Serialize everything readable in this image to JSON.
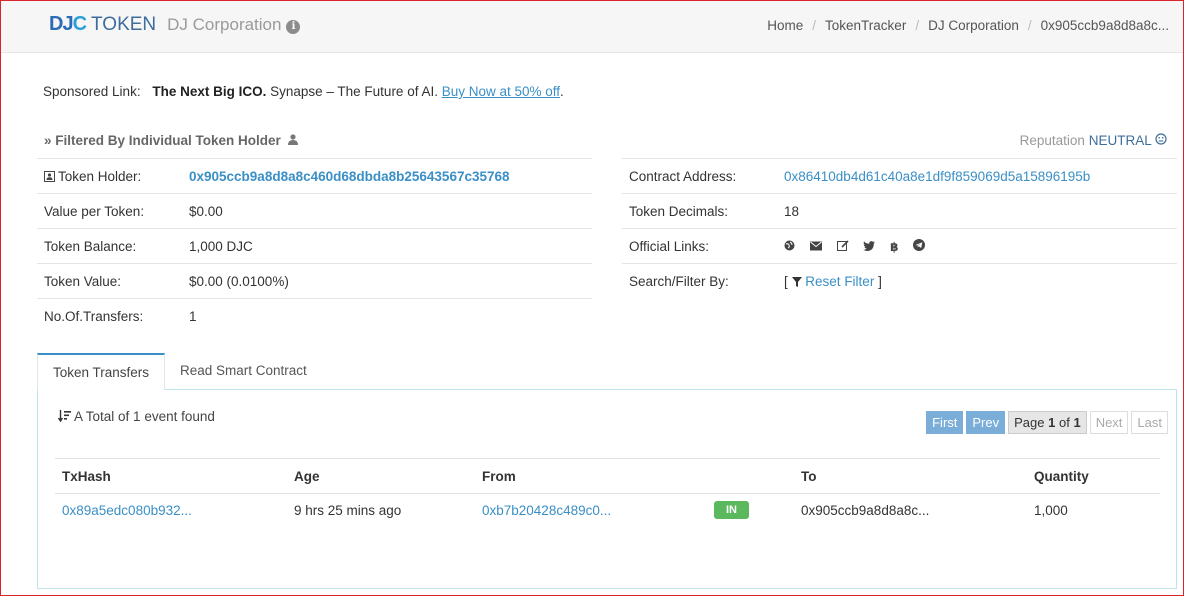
{
  "header": {
    "logo_mark_dj": "DJ",
    "logo_mark_c": "C",
    "logo_token": "TOKEN",
    "logo_name": "DJ Corporation",
    "info_glyph": "i",
    "breadcrumb": [
      "Home",
      "TokenTracker",
      "DJ Corporation",
      "0x905ccb9a8d8a8c..."
    ]
  },
  "sponsored": {
    "label": "Sponsored Link:",
    "bold": "The Next Big ICO.",
    "text": " Synapse – The Future of AI. ",
    "link": "Buy Now at 50% off",
    "tail": "."
  },
  "filter": {
    "title": "» Filtered By Individual Token Holder",
    "reputation_label": "Reputation",
    "reputation_value": "NEUTRAL"
  },
  "holder_info": {
    "token_holder_label": "Token Holder:",
    "token_holder_value": "0x905ccb9a8d8a8c460d68dbda8b25643567c35768",
    "value_per_token_label": "Value per Token:",
    "value_per_token_value": "$0.00",
    "token_balance_label": "Token Balance:",
    "token_balance_value": "1,000 DJC",
    "token_value_label": "Token Value:",
    "token_value_value": "$0.00 (0.0100%)",
    "transfers_label": "No.Of.Transfers:",
    "transfers_value": "1"
  },
  "contract_info": {
    "contract_address_label": "Contract Address:",
    "contract_address_value": "0x86410db4d61c40a8e1df9f859069d5a15896195b",
    "decimals_label": "Token Decimals:",
    "decimals_value": "18",
    "official_links_label": "Official Links:",
    "official_links_icons": [
      "globe-icon",
      "email-icon",
      "edit-icon",
      "twitter-icon",
      "bitcoin-icon",
      "telegram-icon"
    ],
    "search_filter_label": "Search/Filter By:",
    "reset_filter": "Reset Filter",
    "bracket_open": "[",
    "bracket_close": "]"
  },
  "tabs": {
    "token_transfers": "Token Transfers",
    "read_contract": "Read Smart Contract"
  },
  "transfers": {
    "total_text": "A Total of 1 event found",
    "pager": {
      "first": "First",
      "prev": "Prev",
      "page_prefix": "Page",
      "page_current": "1",
      "page_of": "of",
      "page_total": "1",
      "next": "Next",
      "last": "Last"
    },
    "columns": [
      "TxHash",
      "Age",
      "From",
      "",
      "To",
      "Quantity"
    ],
    "rows": [
      {
        "txhash": "0x89a5edc080b932...",
        "age": "9 hrs 25 mins ago",
        "from": "0xb7b20428c489c0...",
        "direction": "IN",
        "to": "0x905ccb9a8d8a8c...",
        "quantity": "1,000"
      }
    ]
  },
  "colors": {
    "accent": "#3a8fc7",
    "in_badge": "#5cb85c",
    "pager_active": "#7aaed9"
  }
}
